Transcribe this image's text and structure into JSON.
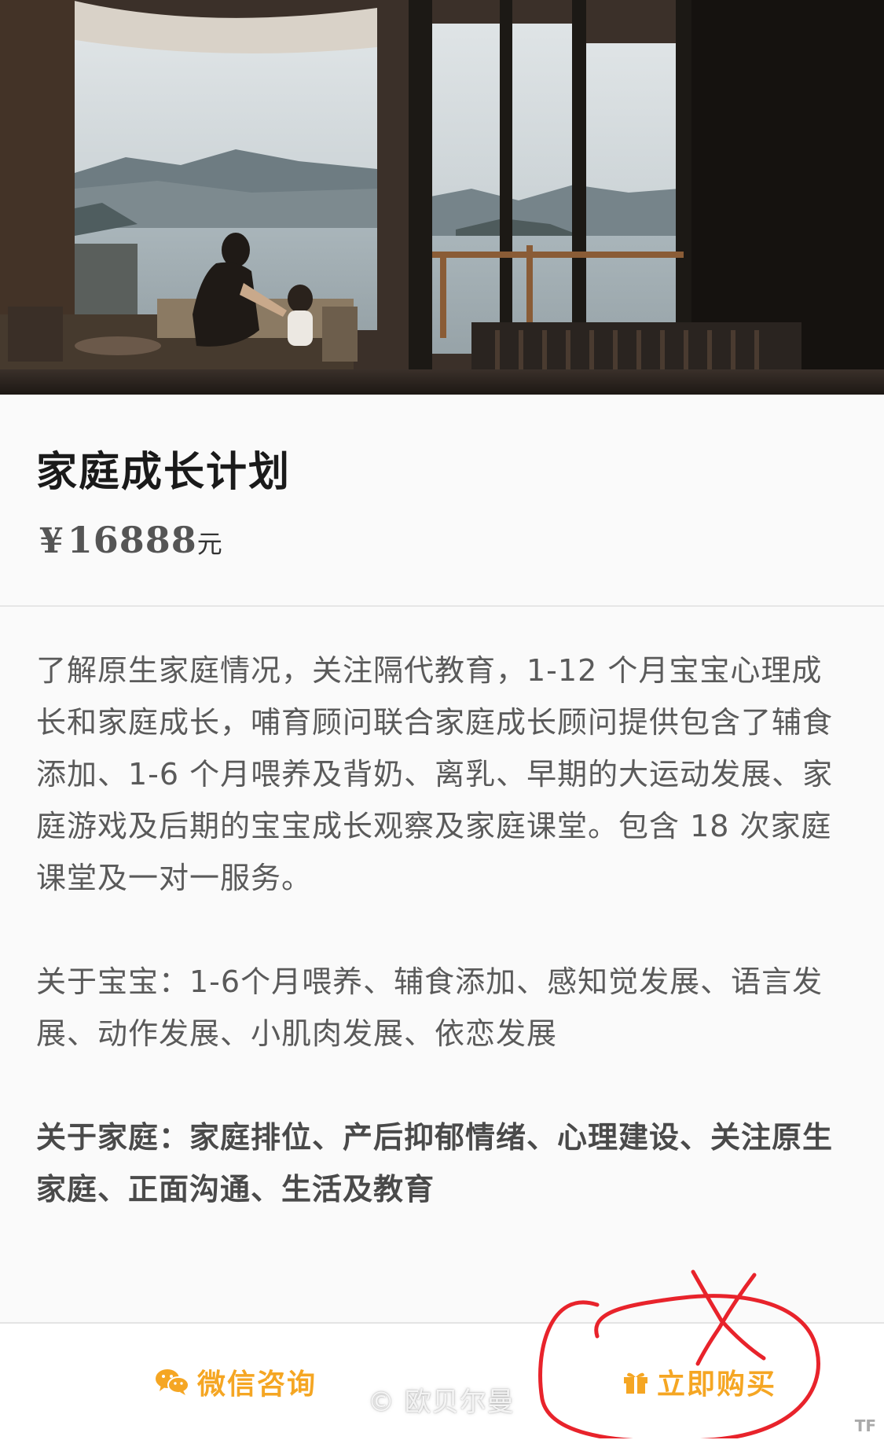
{
  "product": {
    "title": "家庭成长计划",
    "price_currency": "¥",
    "price_amount": "16888",
    "price_unit": "元"
  },
  "description": {
    "paragraphs": [
      "了解原生家庭情况，关注隔代教育，1-12 个月宝宝心理成长和家庭成长，哺育顾问联合家庭成长顾问提供包含了辅食添加、1-6 个月喂养及背奶、离乳、早期的大运动发展、家庭游戏及后期的宝宝成长观察及家庭课堂。包含 18 次家庭课堂及一对一服务。",
      "关于宝宝：1-6个月喂养、辅食添加、感知觉发展、语言发展、动作发展、小肌肉发展、依恋发展",
      "关于家庭：家庭排位、产后抑郁情绪、心理建设、关注原生家庭、正面沟通、生活及教育"
    ]
  },
  "actions": {
    "wechat_label": "微信咨询",
    "buy_label": "立即购买",
    "wechat_icon": "wechat-icon",
    "buy_icon": "gift-icon"
  },
  "overlay": {
    "watermark": "© 欧贝尔曼",
    "corner": "TF"
  },
  "colors": {
    "accent": "#f5a623",
    "annotation": "#e8232b",
    "title": "#1a1a1a",
    "body_text": "#5a5a5a"
  }
}
